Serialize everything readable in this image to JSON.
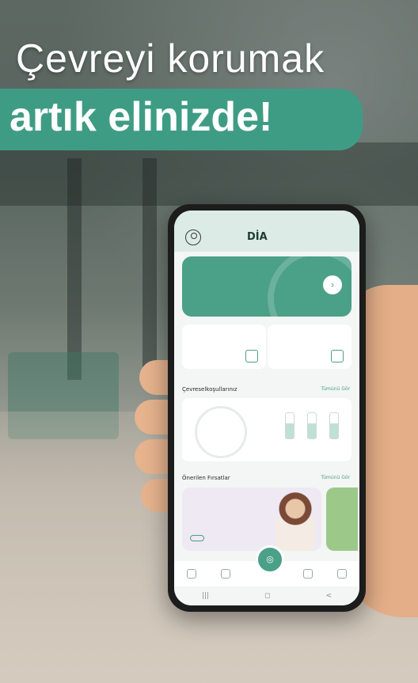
{
  "headline": {
    "line1": "Çevreyi korumak",
    "line2": "artık elinizde!"
  },
  "colors": {
    "brand": "#3f9c84",
    "card": "#4ba088",
    "text_light": "#ffffff"
  },
  "app": {
    "logo": "DİA",
    "card": {
      "go_icon": "chevron-right-icon"
    },
    "sections": {
      "environment_title": "Çevreselkoşullarınız",
      "environment_seeall": "Tümünü Gör",
      "recommended_title": "Önerilen Fırsatlar",
      "recommended_seeall": "Tümünü Gör"
    },
    "navbar": [
      "|||",
      "◻",
      "<"
    ]
  }
}
